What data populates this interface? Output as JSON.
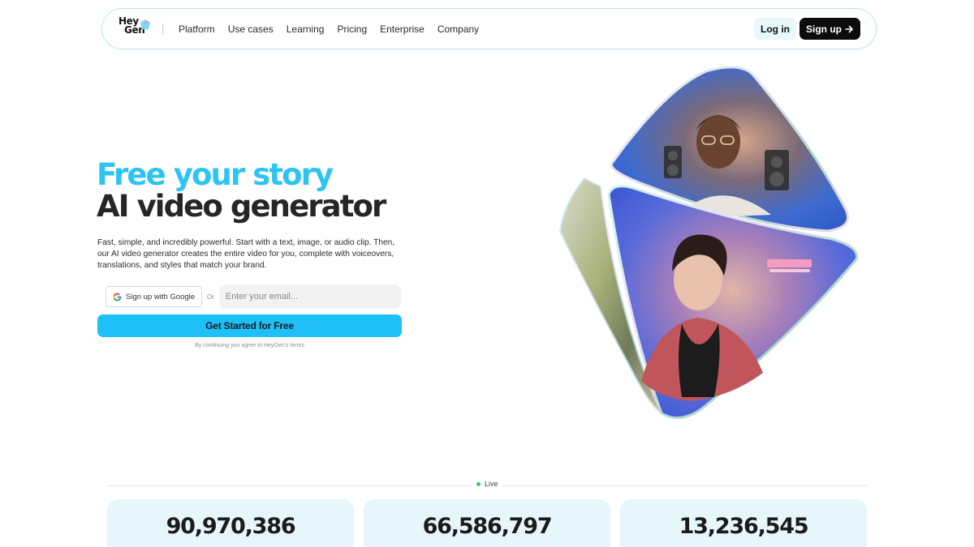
{
  "nav": {
    "logo_line1": "Hey",
    "logo_line2": "Gen",
    "links": [
      "Platform",
      "Use cases",
      "Learning",
      "Pricing",
      "Enterprise",
      "Company"
    ],
    "login_label": "Log in",
    "signup_label": "Sign up",
    "signup_icon": "arrow-right-icon"
  },
  "hero": {
    "headline_accent": "Free your story",
    "headline_main": "AI video generator",
    "description": "Fast, simple, and incredibly powerful. Start with a text, image, or audio clip. Then, our AI video generator creates the entire video for you, complete with voiceovers, translations, and styles that match your brand.",
    "google_button_label": "Sign up with Google",
    "google_icon": "google-icon",
    "or_label": "Or",
    "email_placeholder": "Enter your email...",
    "cta_label": "Get Started for Free",
    "terms": "By continuing you agree to HeyGen's terms"
  },
  "live": {
    "label": "Live",
    "stats": [
      "90,970,386",
      "66,586,797",
      "13,236,545"
    ]
  },
  "colors": {
    "accent": "#2ec4f2",
    "cta": "#1ec0f7",
    "stat_bg": "#e6f6fb",
    "live_dot": "#2ecc71"
  }
}
